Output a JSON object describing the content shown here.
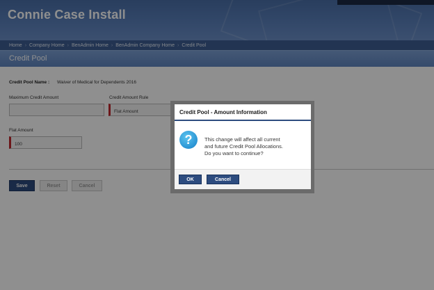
{
  "app": {
    "title": "Connie Case Install"
  },
  "breadcrumb": [
    "Home",
    "Company Home",
    "BenAdmin Home",
    "BenAdmin Company Home",
    "Credit Pool"
  ],
  "breadcrumb_separator": "›",
  "section": {
    "title": "Credit Pool"
  },
  "form": {
    "pool_name_label": "Credit Pool Name :",
    "pool_name_value": "Waiver of Medical for Dependents 2016",
    "max_credit_label": "Maximum Credit Amount",
    "max_credit_value": "",
    "rule_label": "Credit Amount Rule",
    "rule_value": "Flat Amount",
    "flat_label": "Flat Amount",
    "flat_value": "100"
  },
  "buttons": {
    "save": "Save",
    "reset": "Reset",
    "cancel": "Cancel"
  },
  "dialog": {
    "title": "Credit Pool - Amount Information",
    "icon": "?",
    "message_lines": [
      "This change will affect all current",
      "and future Credit Pool Allocations.",
      "Do you want to continue?"
    ],
    "ok": "OK",
    "cancel": "Cancel"
  },
  "colors": {
    "header": "#5a80bb",
    "breadcrumb_bar": "#3d5d92",
    "primary_button": "#2d4c7f",
    "required_marker": "#c0282d",
    "info_icon": "#2a94d4"
  },
  "icons": {
    "dialog_icon": "question-icon"
  }
}
